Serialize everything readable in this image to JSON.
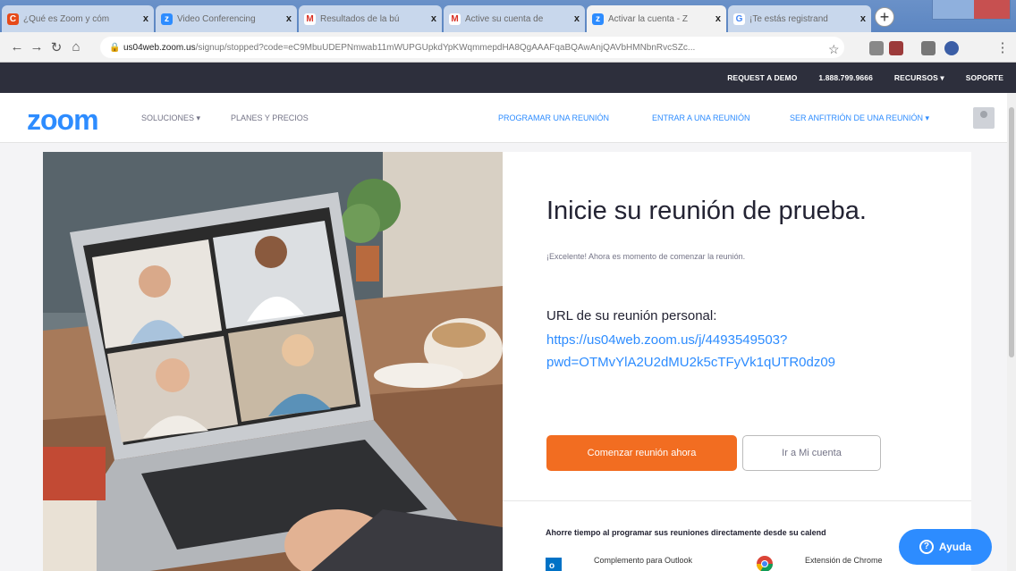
{
  "tabs": [
    {
      "label": "¿Qué es Zoom y cóm",
      "favicon": "C",
      "color": "#e64a19"
    },
    {
      "label": "Video Conferencing",
      "favicon": "z",
      "color": "#2d8cff"
    },
    {
      "label": "Resultados de la bú",
      "favicon": "M",
      "color": "#d93025"
    },
    {
      "label": "Active su cuenta de",
      "favicon": "M",
      "color": "#d93025"
    },
    {
      "label": "Activar la cuenta - Z",
      "favicon": "z",
      "color": "#2d8cff"
    },
    {
      "label": "¡Te estás registrand",
      "favicon": "G",
      "color": "#4285f4"
    }
  ],
  "tab_close": "x",
  "new_tab": "+",
  "address": {
    "domain": "us04web.zoom.us",
    "path": "/signup/stopped?code=eC9MbuUDEPNmwab11mWUPGUpkdYpKWqmmepdHA8QgAAAFqaBQAwAnjQAVbHMNbnRvcSZc..."
  },
  "utility": {
    "request_demo": "REQUEST A DEMO",
    "phone": "1.888.799.9666",
    "resources": "RECURSOS ▾",
    "support": "SOPORTE"
  },
  "nav": {
    "logo": "zoom",
    "solutions": "SOLUCIONES ▾",
    "plans": "PLANES Y PRECIOS",
    "schedule": "PROGRAMAR UNA REUNIÓN",
    "join": "ENTRAR A UNA REUNIÓN",
    "host": "SER ANFITRIÓN DE UNA REUNIÓN ▾"
  },
  "main": {
    "title": "Inicie su reunión de prueba.",
    "subtitle": "¡Excelente! Ahora es momento de comenzar la reunión.",
    "url_label": "URL de su reunión personal:",
    "url_line1": "https://us04web.zoom.us/j/4493549503?",
    "url_line2": "pwd=OTMvYlA2U2dMU2k5cTFyVk1qUTR0dz09",
    "start_button": "Comenzar reunión ahora",
    "account_button": "Ir a Mi cuenta",
    "save_time": "Ahorre tiempo al programar sus reuniones directamente desde su calend",
    "outlook": "Complemento para Outlook",
    "chrome": "Extensión de Chrome"
  },
  "help": {
    "label": "Ayuda"
  },
  "colors": {
    "zoom_blue": "#2d8cff",
    "orange": "#f26d21",
    "dark_bar": "#2d2f3c"
  }
}
